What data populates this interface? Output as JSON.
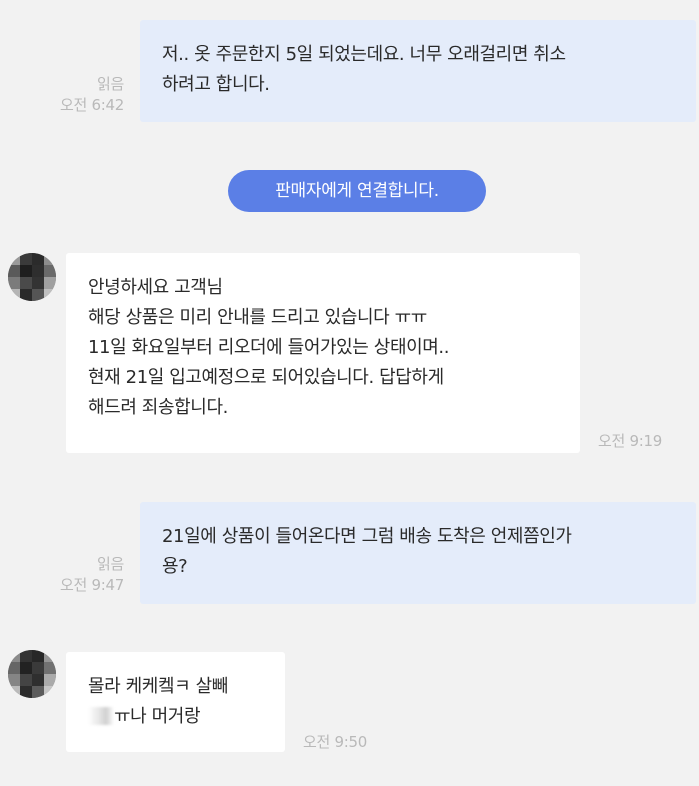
{
  "messages": {
    "m1": {
      "read": "읽음",
      "time": "오전 6:42",
      "lines": [
        "저.. 옷 주문한지 5일 되었는데요. 너무 오래걸리면 취소",
        "하려고 합니다."
      ]
    },
    "system": {
      "text": "판매자에게 연결합니다."
    },
    "m2": {
      "time": "오전 9:19",
      "lines": [
        "안녕하세요 고객님",
        "해당 상품은 미리 안내를 드리고 있습니다 ㅠㅠ",
        "11일 화요일부터 리오더에 들어가있는 상태이며..",
        "현재 21일 입고예정으로 되어있습니다. 답답하게",
        "해드려 죄송합니다."
      ]
    },
    "m3": {
      "read": "읽음",
      "time": "오전 9:47",
      "lines": [
        "21일에 상품이 들어온다면 그럼 배송 도착은 언제쯤인가",
        "용?"
      ]
    },
    "m4": {
      "time": "오전 9:50",
      "lines": [
        "몰라 케케켘ㅋ 살빼",
        "ㅠ나 머거랑"
      ]
    }
  },
  "colors": {
    "background": "#f2f2f2",
    "outgoing_bubble": "#e4ecfa",
    "incoming_bubble": "#ffffff",
    "system_pill": "#5b7fe6",
    "meta_text": "#b9b9b9"
  },
  "icons": {
    "avatar": "pixelated-avatar-icon"
  }
}
